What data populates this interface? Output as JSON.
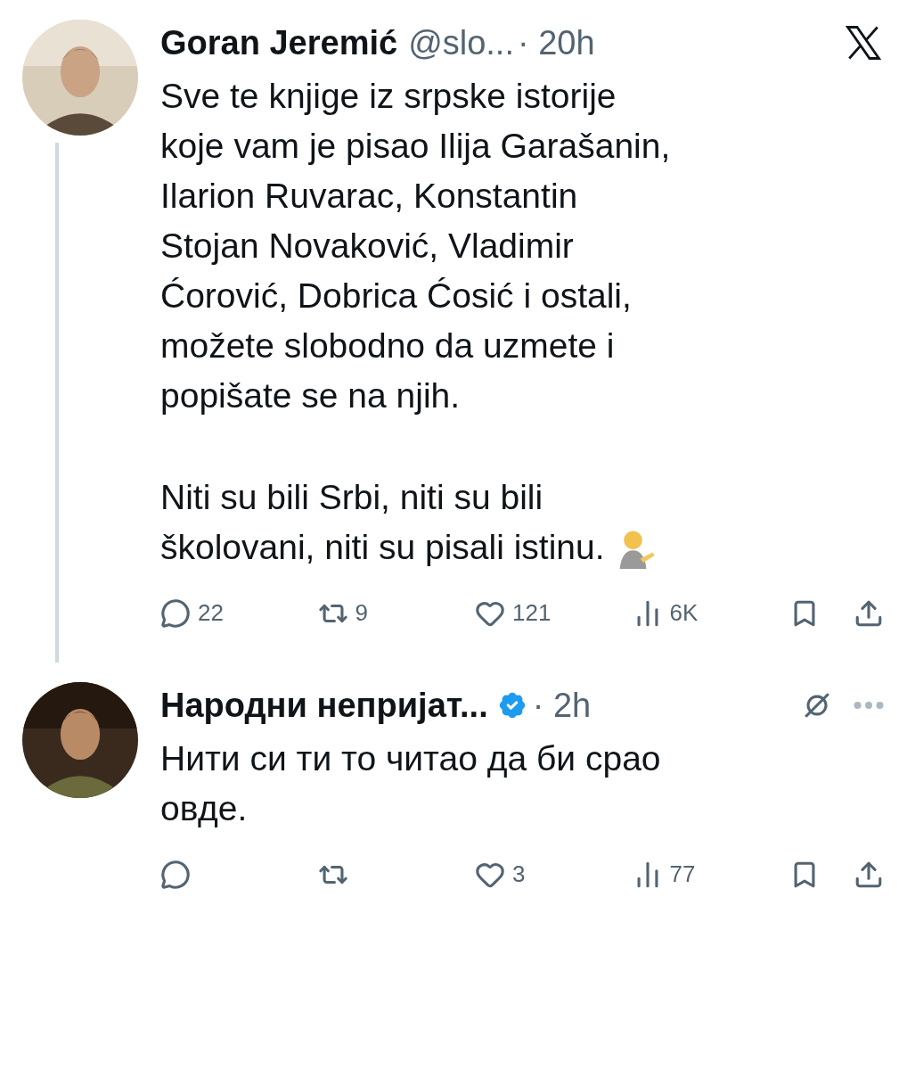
{
  "posts": [
    {
      "name": "Goran Jeremić",
      "handle": "@slo...",
      "time": "· 20h",
      "verified": false,
      "x_logo": true,
      "menu": false,
      "paragraphs": [
        "Sve te knjige iz srpske istorije\nkoje vam je pisao Ilija Garašanin,\nIlarion Ruvarac, Konstantin\nStojan Novaković, Vladimir\nĆorović, Dobrica Ćosić i ostali,\nmožete slobodno da uzmete i\npopišate se na njih.",
        "Niti su bili Srbi, niti su bili\nškolovani, niti su pisali istinu."
      ],
      "emoji_after": true,
      "replies": "22",
      "reposts": "9",
      "likes": "121",
      "views": "6K",
      "thread_line": true
    },
    {
      "name": "Народни непријат...",
      "time": "· 2h",
      "verified": true,
      "x_logo": false,
      "menu": true,
      "paragraphs": [
        "Нити си ти то читао да би срао\nовде."
      ],
      "emoji_after": false,
      "likes": "3",
      "views": "77",
      "thread_line": false
    }
  ]
}
